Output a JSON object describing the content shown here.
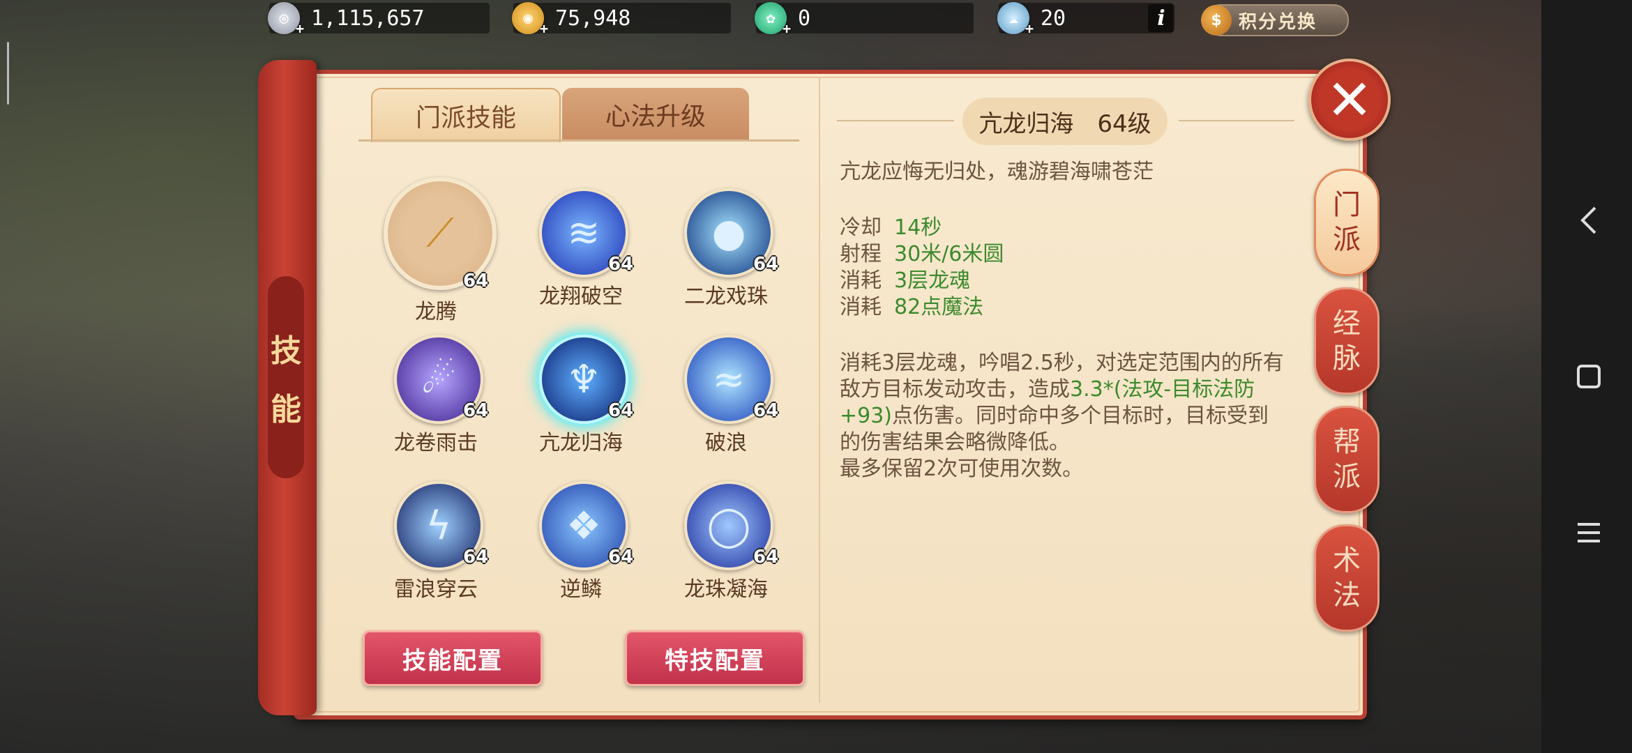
{
  "resources": [
    {
      "icon": "silver-coin-icon",
      "value": "1,115,657",
      "color": "#b8bcc8"
    },
    {
      "icon": "gold-coin-icon",
      "value": "75,948",
      "color": "#e9a836"
    },
    {
      "icon": "jade-icon",
      "value": "0",
      "color": "#38c58d"
    },
    {
      "icon": "cloud-gem-icon",
      "value": "20",
      "color": "#7fb9d9"
    }
  ],
  "info_label": "i",
  "exchange_label": "积分兑换",
  "side_scroll": {
    "chars": [
      "技",
      "能"
    ]
  },
  "tabs": {
    "active": "门派技能",
    "inactive": "心法升级"
  },
  "skills": [
    {
      "name": "龙腾",
      "level": "64"
    },
    {
      "name": "龙翔破空",
      "level": "64"
    },
    {
      "name": "二龙戏珠",
      "level": "64"
    },
    {
      "name": "龙卷雨击",
      "level": "64"
    },
    {
      "name": "亢龙归海",
      "level": "64"
    },
    {
      "name": "破浪",
      "level": "64"
    },
    {
      "name": "雷浪穿云",
      "level": "64"
    },
    {
      "name": "逆鳞",
      "level": "64"
    },
    {
      "name": "龙珠凝海",
      "level": "64"
    }
  ],
  "buttons": {
    "config": "技能配置",
    "special": "特技配置"
  },
  "detail": {
    "name": "亢龙归海",
    "level": "64级",
    "motto": "亢龙应悔无归处，魂游碧海啸苍茫",
    "stats": [
      {
        "key": "冷却",
        "value": "14秒"
      },
      {
        "key": "射程",
        "value": "30米/6米圆"
      },
      {
        "key": "消耗",
        "value": "3层龙魂"
      },
      {
        "key": "消耗",
        "value": "82点魔法"
      }
    ],
    "desc_pre": "消耗3层龙魂，吟唱2.5秒，对选定范围内的所有敌方目标发动攻击，造成",
    "desc_hl": "3.3*(法攻-目标法防+93)",
    "desc_post": "点伤害。同时命中多个目标时，目标受到的伤害结果会略微降低。",
    "desc_extra": "最多保留2次可使用次数。"
  },
  "side_tabs": [
    {
      "label": "门派",
      "chars": [
        "门",
        "派"
      ]
    },
    {
      "label": "经脉",
      "chars": [
        "经",
        "脉"
      ]
    },
    {
      "label": "帮派",
      "chars": [
        "帮",
        "派"
      ]
    },
    {
      "label": "术法",
      "chars": [
        "术",
        "法"
      ]
    }
  ]
}
